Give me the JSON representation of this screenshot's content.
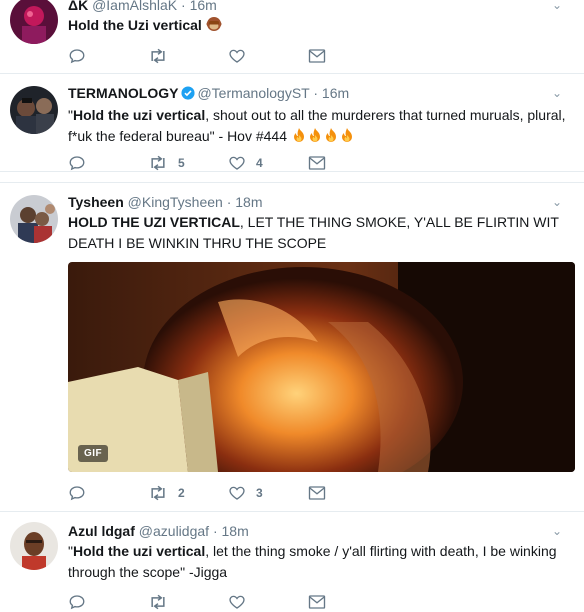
{
  "tweets": [
    {
      "name": "ΔK",
      "handle": "@IamAlshlaK",
      "sep": "·",
      "time": "16m",
      "text_bold": "Hold the Uzi vertical",
      "text_rest": "",
      "emoji": "see-no-evil-monkey",
      "replies": "",
      "retweets": "",
      "likes": ""
    },
    {
      "name": "TERMANOLOGY",
      "handle": "@TermanologyST",
      "sep": "·",
      "time": "16m",
      "verified": true,
      "text_pre": "\"",
      "text_bold": "Hold the uzi vertical",
      "text_rest": ", shout out to all the murderers that turned muruals, plural, f*uk the federal bureau\"  - Hov #444",
      "emoji": "fire x4",
      "replies": "",
      "retweets": "5",
      "likes": "4"
    },
    {
      "name": "Tysheen",
      "handle": "@KingTysheen",
      "sep": "·",
      "time": "18m",
      "text_bold": "HOLD THE UZI VERTICAL",
      "text_rest": ", LET THE THING SMOKE, Y'ALL BE FLIRTIN WIT DEATH I BE WINKIN THRU THE SCOPE",
      "media_badge": "GIF",
      "replies": "",
      "retweets": "2",
      "likes": "3"
    },
    {
      "name": "Azul ldgaf",
      "handle": "@azulidgaf",
      "sep": "·",
      "time": "18m",
      "text_pre": "\"",
      "text_bold": "Hold the uzi vertical",
      "text_rest": ", let the thing smoke / y'all flirting with death, I be winking through the scope\" -Jigga",
      "replies": "",
      "retweets": "",
      "likes": ""
    }
  ],
  "icons": {
    "reply": "reply-icon",
    "retweet": "retweet-icon",
    "like": "heart-icon",
    "message": "envelope-icon",
    "more": "chevron-down-icon"
  },
  "colors": {
    "text": "#14171a",
    "muted": "#657786",
    "verified": "#1da1f2",
    "divider": "#e6ecf0"
  }
}
